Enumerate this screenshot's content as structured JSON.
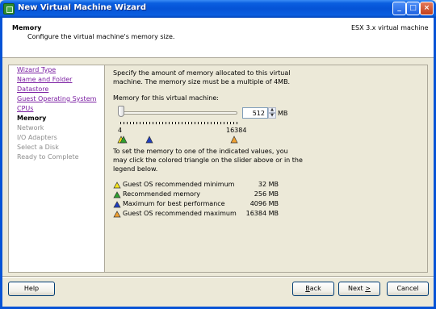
{
  "window": {
    "title": "New Virtual Machine Wizard",
    "controls": {
      "minimize": "_",
      "maximize": "□",
      "close": "×"
    }
  },
  "header": {
    "step_title": "Memory",
    "step_description": "Configure the virtual machine's memory size.",
    "environment": "ESX 3.x virtual machine"
  },
  "nav": {
    "items": [
      {
        "label": "Wizard Type",
        "state": "link"
      },
      {
        "label": "Name and Folder",
        "state": "link"
      },
      {
        "label": "Datastore",
        "state": "link"
      },
      {
        "label": "Guest Operating System",
        "state": "link"
      },
      {
        "label": "CPUs",
        "state": "link"
      },
      {
        "label": "Memory",
        "state": "current"
      },
      {
        "label": "Network",
        "state": "disabled"
      },
      {
        "label": "I/O Adapters",
        "state": "disabled"
      },
      {
        "label": "Select a Disk",
        "state": "disabled"
      },
      {
        "label": "Ready to Complete",
        "state": "disabled"
      }
    ]
  },
  "content": {
    "intro_line1": "Specify the amount of memory allocated to this virtual",
    "intro_line2": "machine. The memory size must be a multiple of 4MB.",
    "memory_label": "Memory for this virtual machine:",
    "memory_value": "512",
    "memory_unit": "MB",
    "slider_min_label": "4",
    "slider_max_label": "16384",
    "slider_value_mb": 512,
    "help_line1": "To set the memory to one of the indicated values, you",
    "help_line2": "may click the colored triangle on the slider above or in the",
    "help_line3": "legend below.",
    "legend": [
      {
        "label": "Guest OS recommended minimum",
        "value": "32 MB",
        "color": "#f5e41a"
      },
      {
        "label": "Recommended memory",
        "value": "256 MB",
        "color": "#2ea12e"
      },
      {
        "label": "Maximum for best performance",
        "value": "4096 MB",
        "color": "#1f3ec0"
      },
      {
        "label": "Guest OS recommended maximum",
        "value": "16384 MB",
        "color": "#f0a030"
      }
    ]
  },
  "buttons": {
    "help": "Help",
    "back_prefix": "",
    "back_key": "B",
    "back_rest": "ack",
    "next_prefix": "Next ",
    "next_key": "&gt;",
    "cancel": "Cancel"
  },
  "colors": {
    "titlebar": "#0553d6",
    "link": "#7b1fa2",
    "disabled": "#8d8d8d"
  }
}
